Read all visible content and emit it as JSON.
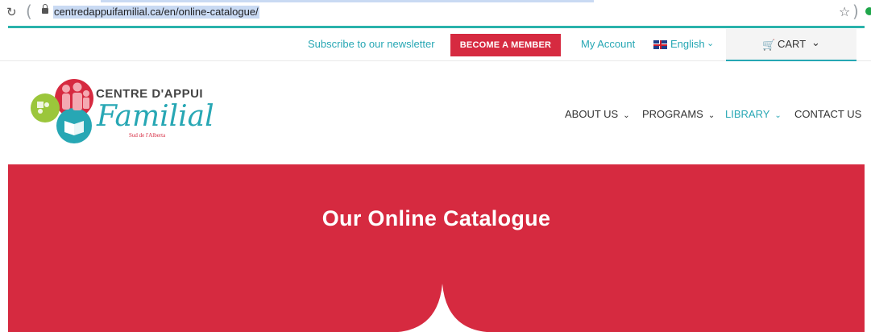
{
  "browser": {
    "url": "centredappuifamilial.ca/en/online-catalogue/",
    "reload_icon": "reload-icon",
    "star_icon": "star-icon"
  },
  "topbar": {
    "newsletter": "Subscribe to our newsletter",
    "member_button": "BECOME A MEMBER",
    "account": "My Account",
    "language": "English",
    "cart": "CART"
  },
  "logo": {
    "brand": "CENTRE D'APPUI",
    "script": "Familial",
    "sub": "Sud de l'Alberta"
  },
  "nav": {
    "items": [
      "ABOUT US",
      "PROGRAMS",
      "LIBRARY",
      "CONTACT US"
    ]
  },
  "hero": {
    "title": "Our Online Catalogue"
  },
  "colors": {
    "brand_red": "#d62a40",
    "brand_teal": "#27a7b4",
    "logo_green": "#9bc63b"
  }
}
